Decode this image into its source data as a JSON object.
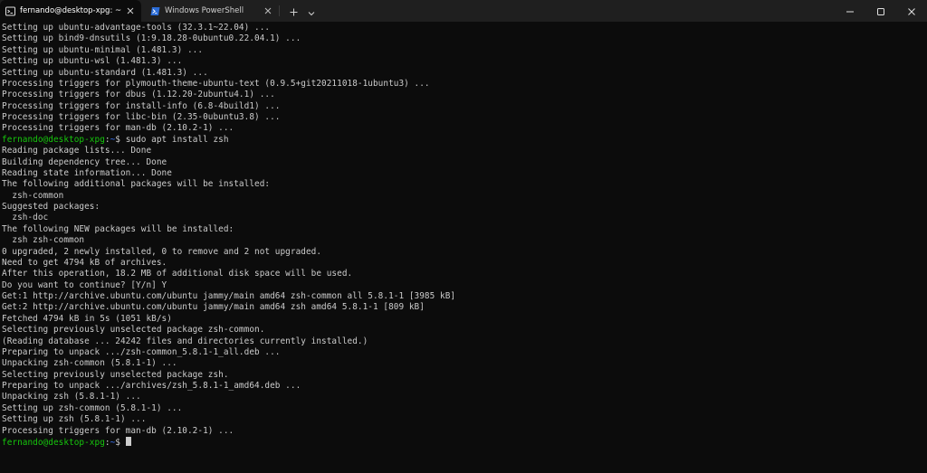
{
  "tabs": [
    {
      "title": "fernando@desktop-xpg: ~",
      "active": true,
      "icon": "terminal-icon"
    },
    {
      "title": "Windows PowerShell",
      "active": false,
      "icon": "powershell-icon"
    }
  ],
  "toolbar": {
    "new_tab_icon": "plus-icon",
    "dropdown_icon": "chevron-down-icon"
  },
  "window_controls": [
    "minimize-icon",
    "maximize-icon",
    "close-icon"
  ],
  "colors": {
    "prompt_user": "#16c60c",
    "prompt_path": "#3b78ff",
    "text": "#cccccc",
    "background": "#0c0c0c"
  },
  "terminal": {
    "lines_before": [
      "Setting up ubuntu-advantage-tools (32.3.1~22.04) ...",
      "Setting up bind9-dnsutils (1:9.18.28-0ubuntu0.22.04.1) ...",
      "Setting up ubuntu-minimal (1.481.3) ...",
      "Setting up ubuntu-wsl (1.481.3) ...",
      "Setting up ubuntu-standard (1.481.3) ...",
      "Processing triggers for plymouth-theme-ubuntu-text (0.9.5+git20211018-1ubuntu3) ...",
      "Processing triggers for dbus (1.12.20-2ubuntu4.1) ...",
      "Processing triggers for install-info (6.8-4build1) ...",
      "Processing triggers for libc-bin (2.35-0ubuntu3.8) ...",
      "Processing triggers for man-db (2.10.2-1) ..."
    ],
    "prompt": {
      "user": "fernando@desktop-xpg",
      "sep": ":",
      "path": "~",
      "symbol": "$ "
    },
    "command": "sudo apt install zsh",
    "output": [
      "Reading package lists... Done",
      "Building dependency tree... Done",
      "Reading state information... Done",
      "The following additional packages will be installed:",
      "  zsh-common",
      "Suggested packages:",
      "  zsh-doc",
      "The following NEW packages will be installed:",
      "  zsh zsh-common",
      "0 upgraded, 2 newly installed, 0 to remove and 2 not upgraded.",
      "Need to get 4794 kB of archives.",
      "After this operation, 18.2 MB of additional disk space will be used.",
      "Do you want to continue? [Y/n] Y",
      "Get:1 http://archive.ubuntu.com/ubuntu jammy/main amd64 zsh-common all 5.8.1-1 [3985 kB]",
      "Get:2 http://archive.ubuntu.com/ubuntu jammy/main amd64 zsh amd64 5.8.1-1 [809 kB]",
      "Fetched 4794 kB in 5s (1051 kB/s)",
      "Selecting previously unselected package zsh-common.",
      "(Reading database ... 24242 files and directories currently installed.)",
      "Preparing to unpack .../zsh-common_5.8.1-1_all.deb ...",
      "Unpacking zsh-common (5.8.1-1) ...",
      "Selecting previously unselected package zsh.",
      "Preparing to unpack .../archives/zsh_5.8.1-1_amd64.deb ...",
      "Unpacking zsh (5.8.1-1) ...",
      "Setting up zsh-common (5.8.1-1) ...",
      "Setting up zsh (5.8.1-1) ...",
      "Processing triggers for man-db (2.10.2-1) ..."
    ]
  }
}
